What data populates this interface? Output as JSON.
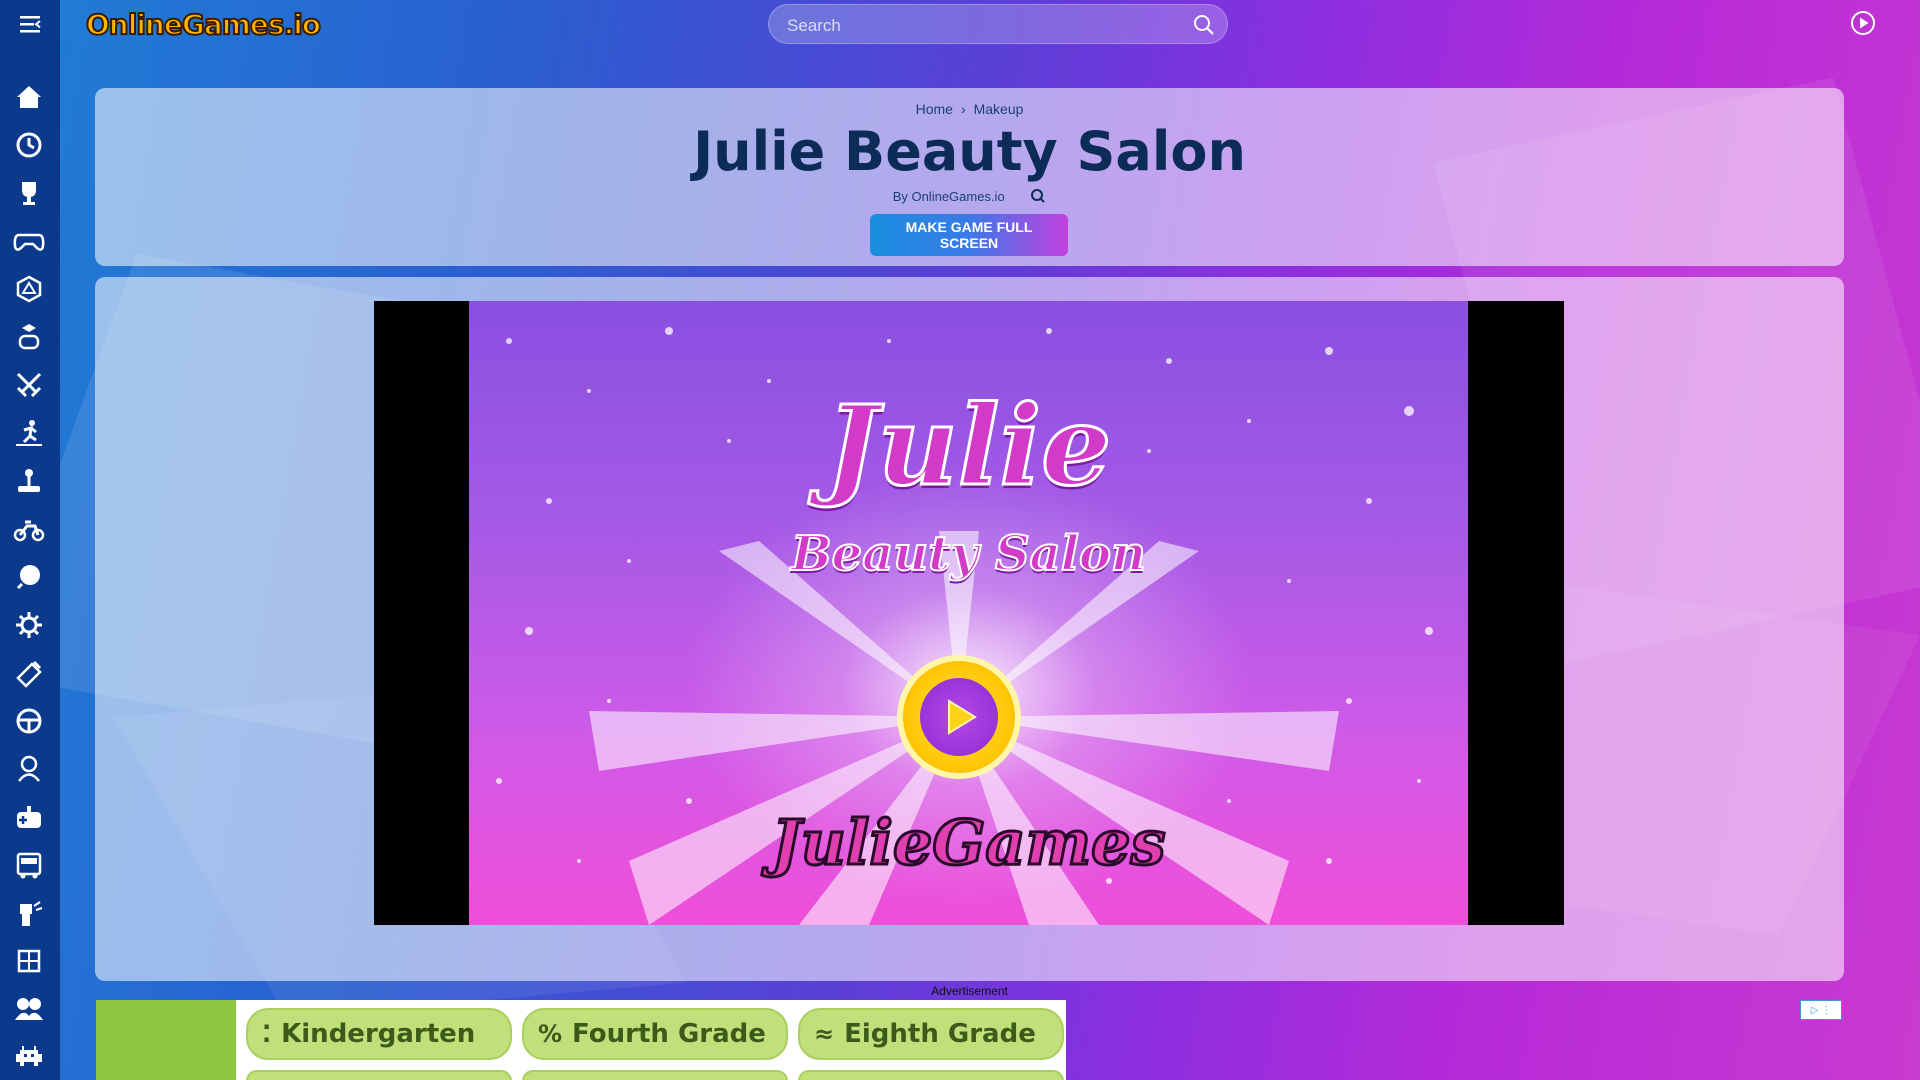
{
  "site": {
    "logo_text": "OnlineGames.io",
    "search_placeholder": "Search"
  },
  "sidebar": {
    "icons": [
      "home-icon",
      "history-icon",
      "trophy-icon",
      "gamepad-icon",
      "dice-icon",
      "cube-gamepad-icon",
      "swords-icon",
      "runner-icon",
      "joystick-icon",
      "motorbike-icon",
      "ball-icon",
      "gear-icon",
      "shooter-icon",
      "steering-wheel-icon",
      "girl-icon",
      "controller-plus-icon",
      "bus-icon",
      "robot-icon",
      "puzzle-icon",
      "friends-icon",
      "space-invader-icon"
    ]
  },
  "header": {
    "breadcrumb": [
      "Home",
      "Makeup"
    ],
    "title": "Julie Beauty Salon",
    "byline": "By OnlineGames.io",
    "fullscreen_label": "MAKE GAME FULL SCREEN"
  },
  "game": {
    "title_line1": "Julie",
    "title_line2": "Beauty Salon",
    "brand": "JulieGames"
  },
  "ad": {
    "label": "Advertisement",
    "tabs": [
      {
        "glyph": "⁚",
        "label": "Kindergarten"
      },
      {
        "glyph": "%",
        "label": "Fourth Grade"
      },
      {
        "glyph": "≈",
        "label": "Eighth Grade"
      }
    ]
  },
  "colors": {
    "sidebar": "#0b3a8c",
    "title": "#0d2b57",
    "accent_blue": "#1a8fe0",
    "accent_purple": "#c43fe0",
    "game_purple": "#8a4fe0",
    "game_pink": "#ef4fd8"
  }
}
